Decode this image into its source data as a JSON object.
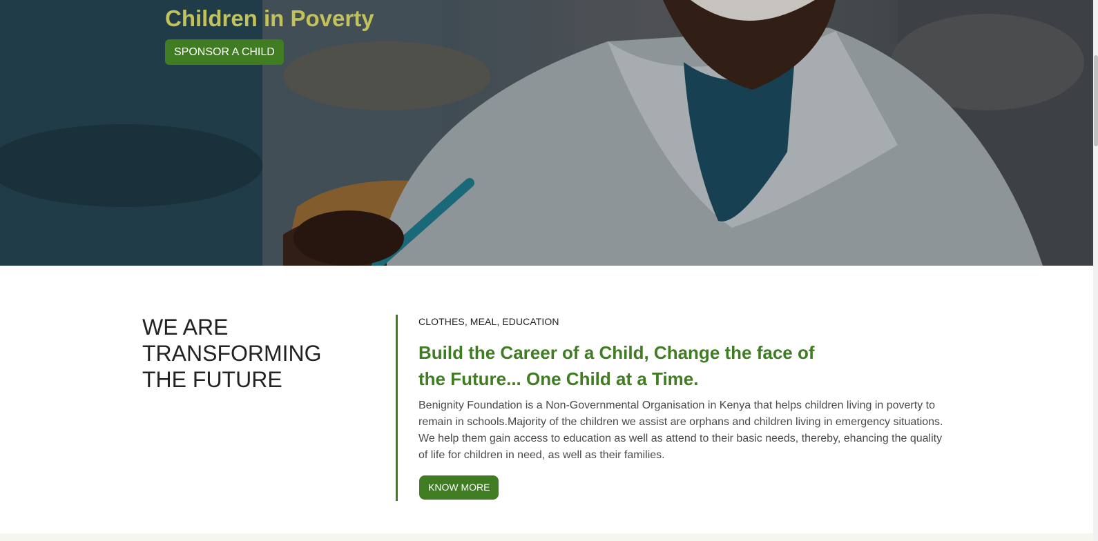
{
  "hero": {
    "title": "Children in Poverty",
    "cta_label": "SPONSOR A CHILD",
    "image_name": "student-smiling-at-desk-photo"
  },
  "about": {
    "heading": "WE ARE TRANSFORMING THE FUTURE",
    "tagline": "CLOTHES, MEAL, EDUCATION",
    "title": "Build the Career of a Child, Change the face of the Future... One Child at a Time.",
    "body": "Benignity Foundation is a Non-Governmental Organisation in Kenya that helps children living in poverty to remain in schools.Majority of the children we assist are orphans and children living in emergency situations. We help them gain access to education as well as attend to their basic needs, thereby, ehancing the quality of life for children in need, as well as their families.",
    "cta_label": "KNOW MORE"
  },
  "colors": {
    "brand_green": "#3f7c22",
    "hero_title": "#c3c25a",
    "heading_text": "#222222",
    "body_text": "#4a4a4a",
    "strip_bg": "#f5f6ef"
  }
}
